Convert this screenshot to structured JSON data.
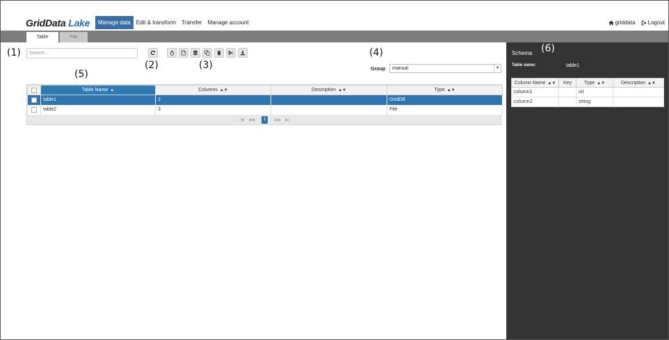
{
  "app": {
    "brand_main": "GridData",
    "brand_accent": "Lake",
    "accent_color": "#1f6fb2"
  },
  "nav": {
    "items": [
      {
        "label": "Manage data",
        "active": true
      },
      {
        "label": "Edit & transform",
        "active": false
      },
      {
        "label": "Transfer",
        "active": false
      },
      {
        "label": "Manage account",
        "active": false
      }
    ],
    "user": "griddata",
    "logout": "Logout"
  },
  "tabs": {
    "table": "Table",
    "file": "File"
  },
  "search": {
    "placeholder": "Search..."
  },
  "toolbar": {
    "refresh_icon": "refresh-icon",
    "buttons": [
      "pointer-icon",
      "new-file-icon",
      "database-icon",
      "copy-icon",
      "delete-icon",
      "cut-icon",
      "download-icon"
    ]
  },
  "group": {
    "label": "Group",
    "value": "manual"
  },
  "table": {
    "headers": {
      "name": "Table Name",
      "columns": "Columns",
      "description": "Description",
      "type": "Type"
    },
    "rows": [
      {
        "name": "table1",
        "columns": "2",
        "description": "",
        "type": "GridDB",
        "selected": true
      },
      {
        "name": "table2",
        "columns": "3",
        "description": "",
        "type": "File",
        "selected": false
      }
    ],
    "current_page": "1"
  },
  "schema": {
    "title": "Schema",
    "table_name_label": "Table name:",
    "table_name_value": "table1",
    "headers": {
      "column_name": "Column Name",
      "key": "Key",
      "type": "Type",
      "description": "Description"
    },
    "rows": [
      {
        "column_name": "column1",
        "key": "",
        "type": "int",
        "description": ""
      },
      {
        "column_name": "column2",
        "key": "",
        "type": "string",
        "description": ""
      }
    ]
  },
  "callouts": {
    "c1": "(1)",
    "c2": "(2)",
    "c3": "(3)",
    "c4": "(4)",
    "c5": "(5)",
    "c6": "(6)"
  }
}
